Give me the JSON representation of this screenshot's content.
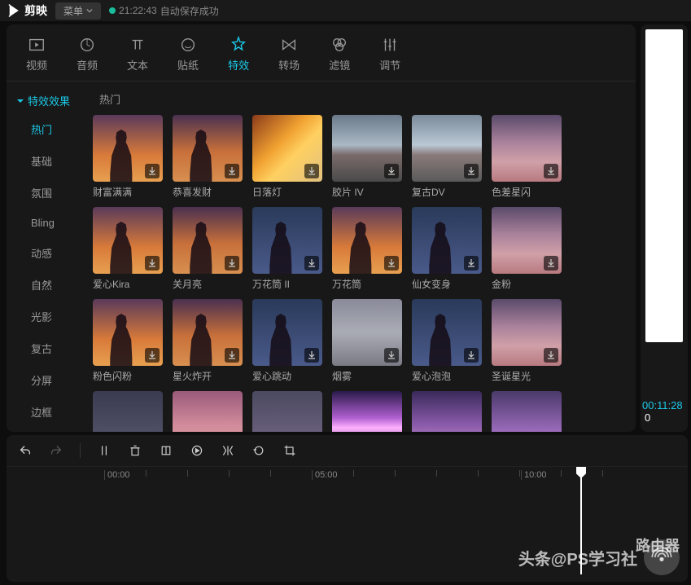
{
  "titlebar": {
    "app_name": "剪映",
    "menu": "菜单",
    "autosave_time": "21:22:43",
    "autosave_text": "自动保存成功"
  },
  "tabs": [
    {
      "label": "视频",
      "icon": "video"
    },
    {
      "label": "音频",
      "icon": "audio"
    },
    {
      "label": "文本",
      "icon": "text"
    },
    {
      "label": "贴纸",
      "icon": "sticker"
    },
    {
      "label": "特效",
      "icon": "effect"
    },
    {
      "label": "转场",
      "icon": "transition"
    },
    {
      "label": "滤镜",
      "icon": "filter"
    },
    {
      "label": "调节",
      "icon": "adjust"
    }
  ],
  "active_tab": "特效",
  "sidebar": {
    "header": "特效效果",
    "items": [
      "热门",
      "基础",
      "氛围",
      "Bling",
      "动感",
      "自然",
      "光影",
      "复古",
      "分屏",
      "边框"
    ],
    "active": "热门"
  },
  "section_title": "热门",
  "effects": [
    {
      "label": "财富满满",
      "bg": "bg-sunset silhouette"
    },
    {
      "label": "恭喜发财",
      "bg": "bg-sunset2 silhouette"
    },
    {
      "label": "日落灯",
      "bg": "bg-lamp"
    },
    {
      "label": "胶片 IV",
      "bg": "bg-car"
    },
    {
      "label": "复古DV",
      "bg": "bg-car2"
    },
    {
      "label": "色差星闪",
      "bg": "bg-clouds-pink"
    },
    {
      "label": "爱心Kira",
      "bg": "bg-sunset silhouette"
    },
    {
      "label": "关月亮",
      "bg": "bg-sunset2 silhouette"
    },
    {
      "label": "万花筒 II",
      "bg": "bg-night silhouette"
    },
    {
      "label": "万花筒",
      "bg": "bg-sunset silhouette"
    },
    {
      "label": "仙女变身",
      "bg": "bg-night silhouette"
    },
    {
      "label": "金粉",
      "bg": "bg-clouds-pink"
    },
    {
      "label": "粉色闪粉",
      "bg": "bg-sunset silhouette"
    },
    {
      "label": "星火炸开",
      "bg": "bg-sunset2 silhouette"
    },
    {
      "label": "爱心跳动",
      "bg": "bg-night silhouette"
    },
    {
      "label": "烟雾",
      "bg": "bg-smoke"
    },
    {
      "label": "爱心泡泡",
      "bg": "bg-night silhouette"
    },
    {
      "label": "圣诞星光",
      "bg": "bg-clouds-pink"
    },
    {
      "label": "",
      "bg": "bg-moon"
    },
    {
      "label": "",
      "bg": "bg-pink-clouds"
    },
    {
      "label": "",
      "bg": "bg-starry"
    },
    {
      "label": "",
      "bg": "bg-concert"
    },
    {
      "label": "",
      "bg": "bg-purple"
    },
    {
      "label": "",
      "bg": "bg-purple2"
    }
  ],
  "preview": {
    "timecode": "00:11:28",
    "suffix": "0"
  },
  "timeline": {
    "marks": [
      "00:00",
      "05:00",
      "10:00"
    ]
  },
  "watermark": {
    "text": "头条@PS学习社",
    "sub": "路由器"
  }
}
